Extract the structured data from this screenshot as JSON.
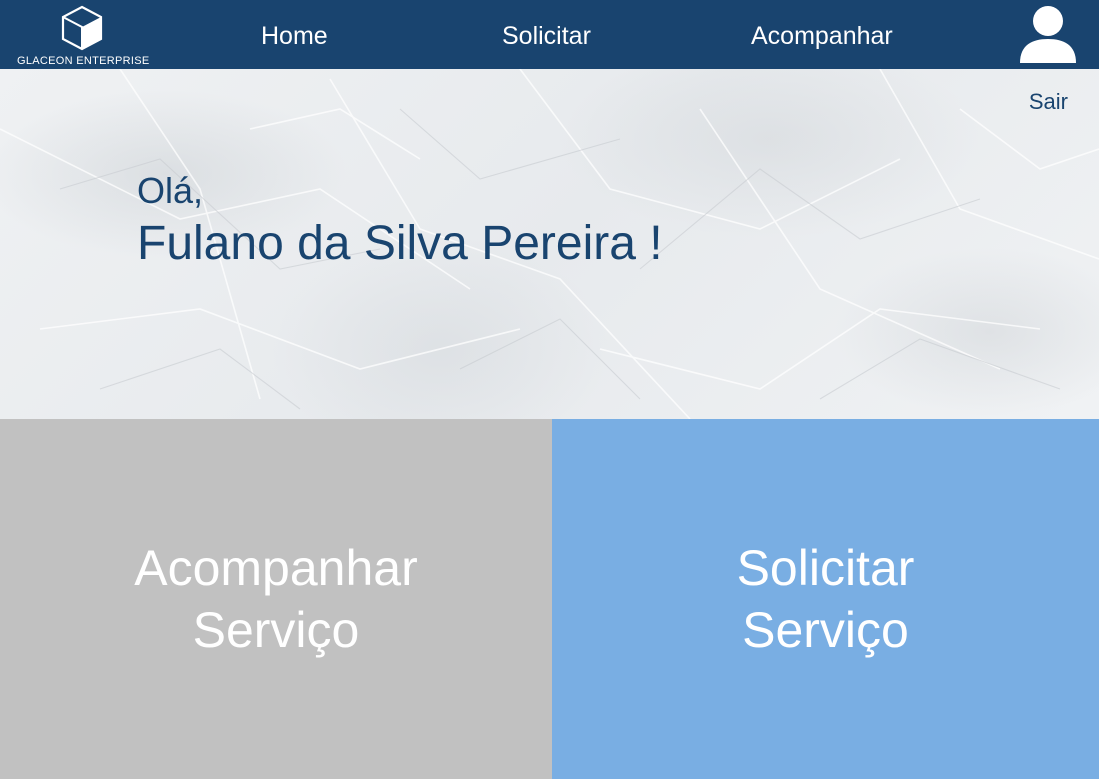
{
  "header": {
    "logo_text": "GLACEON  ENTERPRISE",
    "nav": {
      "home": "Home",
      "solicitar": "Solicitar",
      "acompanhar": "Acompanhar"
    },
    "avatar_icon": "user-icon",
    "background_color": "#19446f"
  },
  "hero": {
    "logout_label": "Sair",
    "greeting": "Olá,",
    "user_name": "Fulano da Silva Pereira !"
  },
  "tiles": {
    "acompanhar": {
      "line1": "Acompanhar",
      "line2": "Serviço",
      "color": "#c1c1c1"
    },
    "solicitar": {
      "line1": "Solicitar",
      "line2": "Serviço",
      "color": "#79aee3"
    }
  }
}
